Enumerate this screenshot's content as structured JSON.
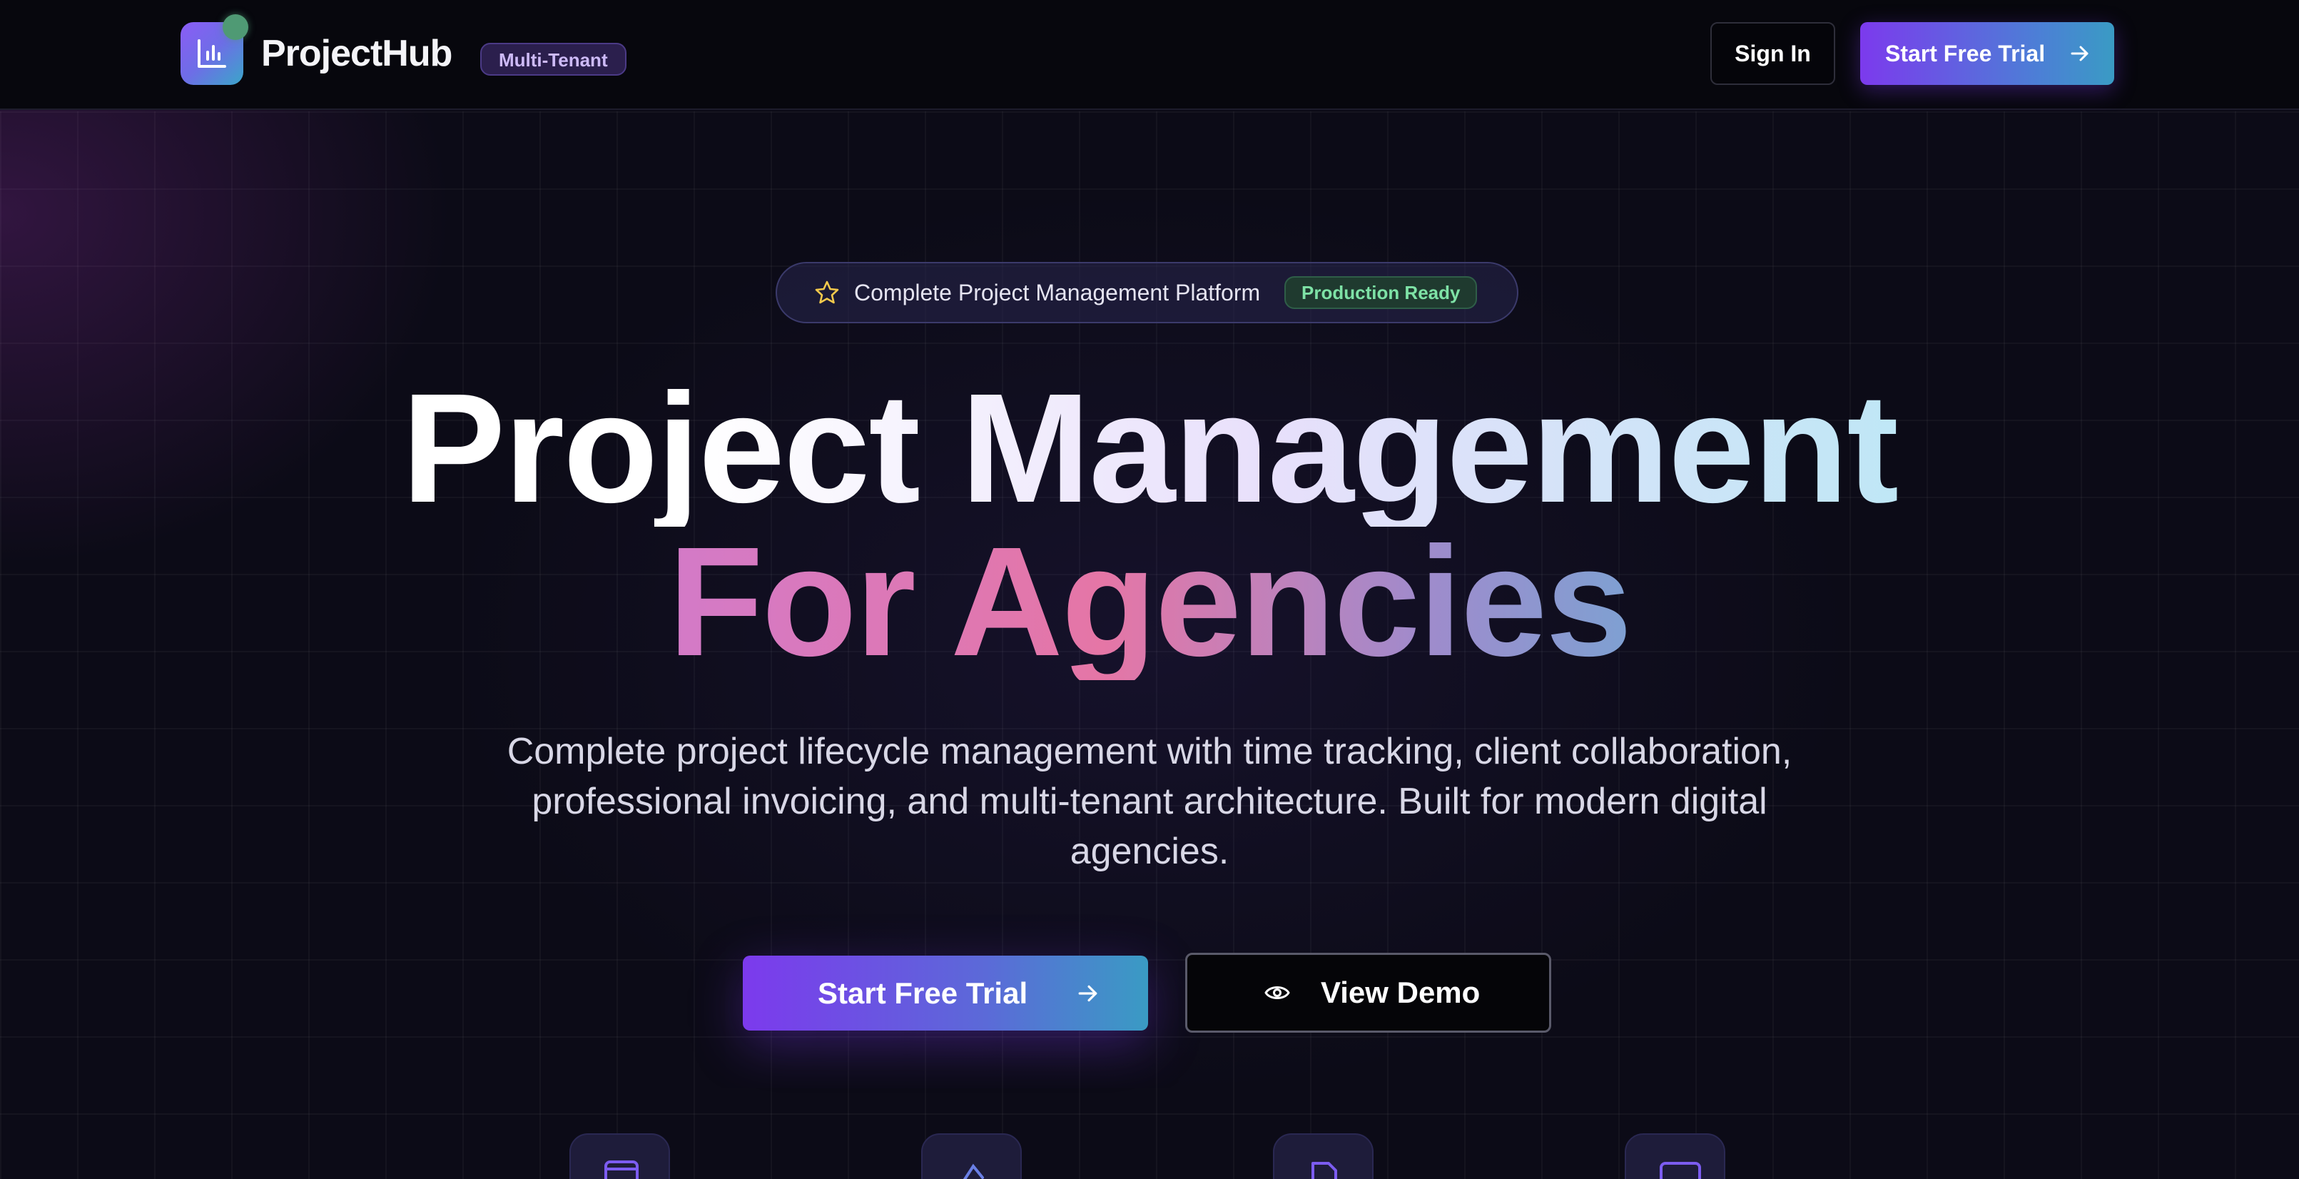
{
  "nav": {
    "brand_name": "ProjectHub",
    "tenant_badge": "Multi-Tenant",
    "sign_in": "Sign In",
    "start_trial": "Start Free Trial"
  },
  "hero": {
    "pill_text": "Complete Project Management Platform",
    "pill_badge": "Production Ready",
    "headline_line1": "Project Management",
    "headline_line2": "For Agencies",
    "subtitle": "Complete project lifecycle management with time tracking, client collaboration, professional invoicing, and multi-tenant architecture. Built for modern digital agencies.",
    "cta_primary": "Start Free Trial",
    "cta_secondary": "View Demo"
  },
  "icons": {
    "logo": "bar-chart-icon",
    "pill": "star-icon",
    "arrow": "arrow-right-icon",
    "demo": "eye-icon",
    "features": [
      "calendar-icon",
      "chart-icon",
      "document-icon",
      "card-icon"
    ]
  },
  "colors": {
    "accent_purple": "#7c3aed",
    "accent_cyan": "#3a9bc4",
    "ready_green": "#7ee2a6",
    "background": "#0c0b17"
  }
}
